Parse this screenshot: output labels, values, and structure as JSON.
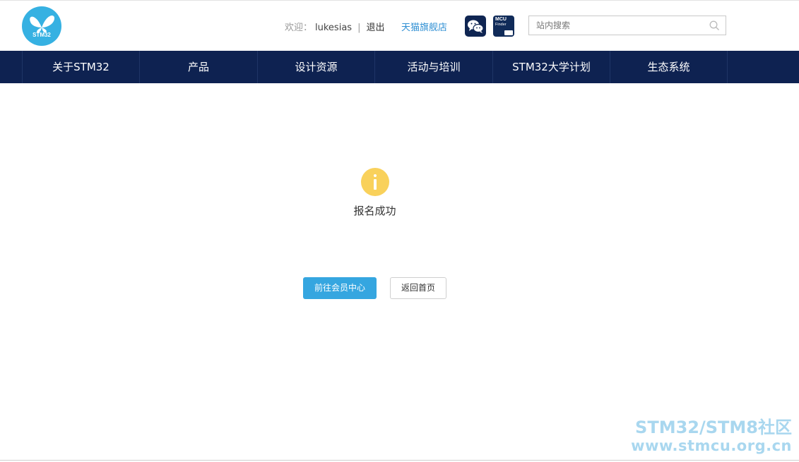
{
  "header": {
    "logo_text": "STM32",
    "welcome_label": "欢迎：",
    "username": "lukesias",
    "separator": "|",
    "logout_label": "退出",
    "tmall_label": "天猫旗舰店",
    "mcu_finder": {
      "line1": "MCU",
      "line2": "Finder"
    },
    "search": {
      "placeholder": "站内搜索",
      "value": ""
    }
  },
  "nav": {
    "items": [
      {
        "label": "关于STM32"
      },
      {
        "label": "产品"
      },
      {
        "label": "设计资源"
      },
      {
        "label": "活动与培训"
      },
      {
        "label": "STM32大学计划"
      },
      {
        "label": "生态系统"
      }
    ]
  },
  "main": {
    "status_text": "报名成功",
    "primary_button": "前往会员中心",
    "secondary_button": "返回首页"
  },
  "watermark": {
    "line1": "STM32/STM8社区",
    "line2": "www.stmcu.org.cn"
  },
  "colors": {
    "nav_bg": "#0e2251",
    "accent": "#35a6e0",
    "info_icon": "#f9d15b",
    "logo_bg": "#36b1e2"
  }
}
